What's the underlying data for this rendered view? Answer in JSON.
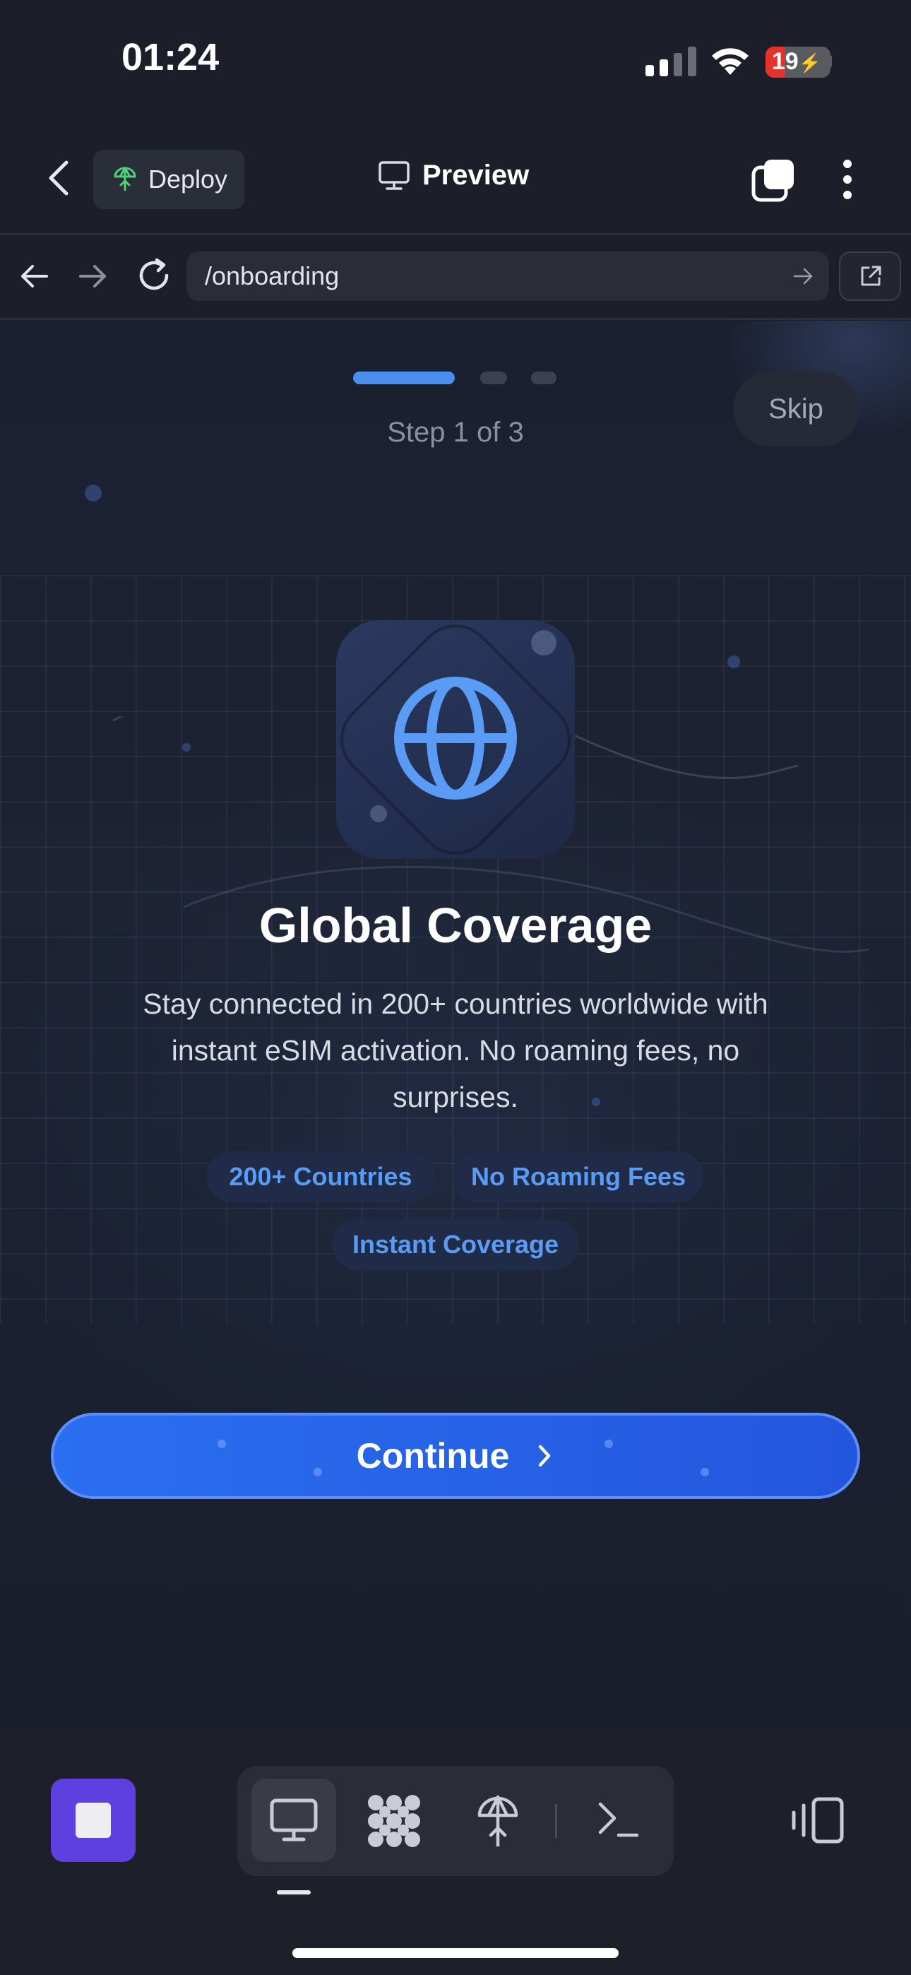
{
  "status_bar": {
    "time": "01:24",
    "battery": "19",
    "battery_level": 0.19
  },
  "header": {
    "deploy_label": "Deploy",
    "preview_label": "Preview"
  },
  "browser": {
    "url": "/onboarding"
  },
  "onboarding": {
    "step_label": "Step 1 of 3",
    "current_step": 1,
    "total_steps": 3,
    "skip_label": "Skip",
    "icon": "globe-icon",
    "title": "Global Coverage",
    "description": "Stay connected in 200+ countries worldwide with instant eSIM activation. No roaming fees, no surprises.",
    "chips": [
      "200+ Countries",
      "No Roaming Fees",
      "Instant Coverage"
    ],
    "cta_label": "Continue"
  },
  "toolbar": {
    "tabs": [
      "preview-icon",
      "apps-icon",
      "deploy-icon",
      "terminal-icon"
    ],
    "active_tab": "preview-icon"
  },
  "colors": {
    "accent": "#2a6ff0",
    "chip_text": "#5a9cf5",
    "stop_button": "#5e3fe0",
    "battery_low": "#e5322d"
  }
}
